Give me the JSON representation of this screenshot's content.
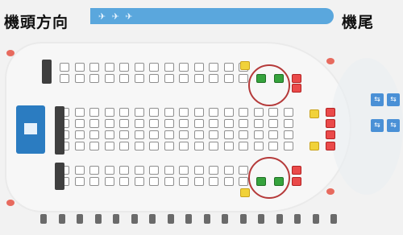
{
  "header": {
    "front_label": "機頭方向",
    "rear_label": "機尾"
  },
  "colors": {
    "banner": "#5aa7dd",
    "seat_available": "#ffffff",
    "seat_yellow": "#f1d23a",
    "seat_green": "#36a33d",
    "seat_red": "#ea4a4a",
    "highlight_circle": "#b53a3a",
    "galley": "#2b7cc1"
  },
  "highlights": {
    "circled_seat_groups": 2
  }
}
